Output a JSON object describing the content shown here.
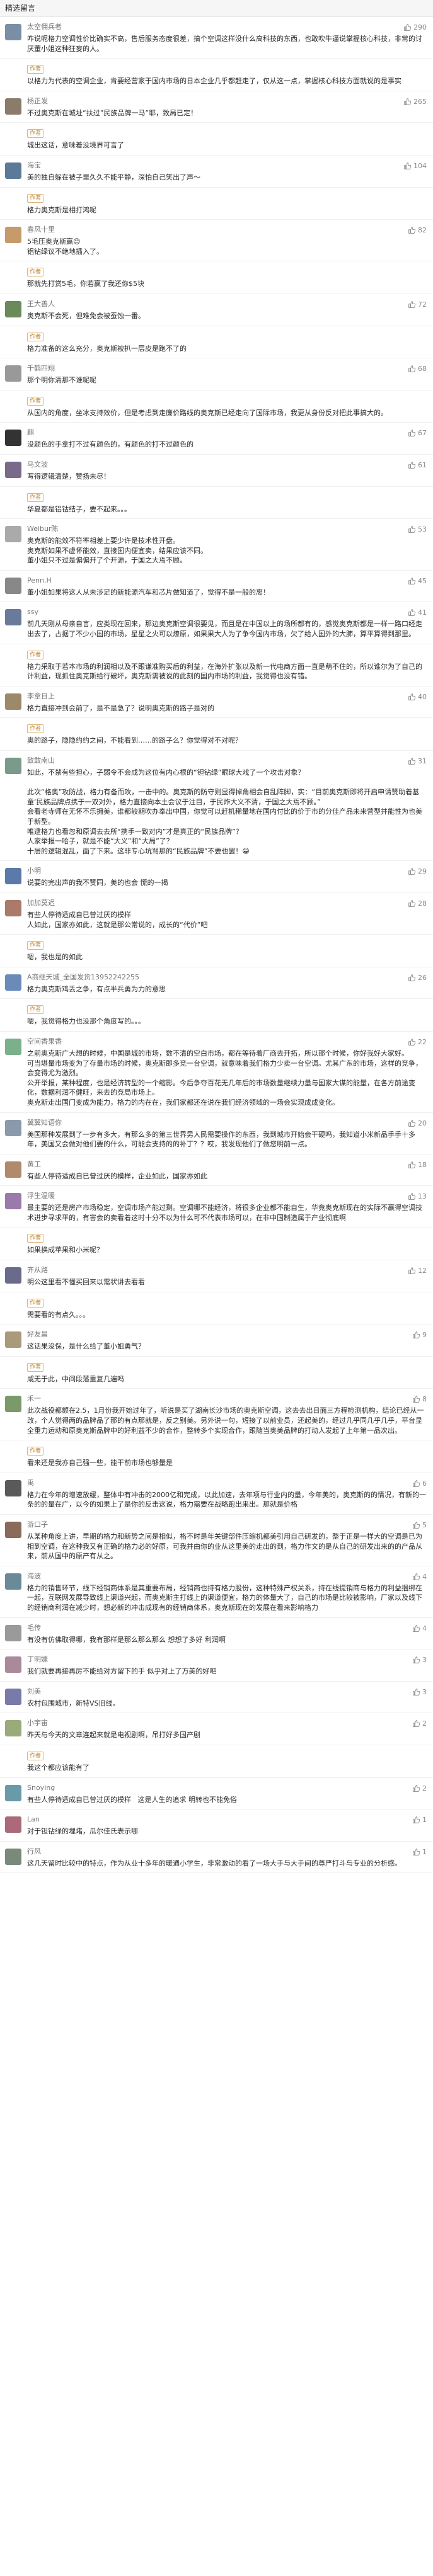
{
  "section_title": "精选留言",
  "colors": {
    "author_tag": "#c08a2e",
    "accent": "#4a90e2"
  },
  "comments": [
    {
      "prefix": "",
      "user": "太空佣兵者",
      "author_tag": "",
      "likes": "290",
      "avatar_color": "#7a8fa6",
      "text": "咋说呢格力空调性价比确实不高，售后服务态度很差，搞个空调这样没什么高科技的东西，也敢吹牛逼说掌握核心科技，非常的讨厌董小姐这种狂妄的人。"
    },
    {
      "prefix": "",
      "user": "",
      "author_tag": "作者",
      "likes": "",
      "avatar_color": "#ffffff",
      "text": "以格力为代表的空调企业，肯要经营家于国内市场的日本企业几乎都赶走了，仅从这一点，掌握核心科技方面就说的是事实"
    },
    {
      "prefix": "",
      "user": "杨正发",
      "author_tag": "",
      "likes": "265",
      "avatar_color": "#8a7b6a",
      "text": "不过奥克斯在城址“扶过”民族品牌一马”耶，致局已定！"
    },
    {
      "prefix": "",
      "user": "",
      "author_tag": "作者",
      "likes": "",
      "avatar_color": "#ffffff",
      "text": "城出这话，意味着没境界可言了"
    },
    {
      "prefix": "",
      "user": "海宝",
      "author_tag": "",
      "likes": "104",
      "avatar_color": "#5b7a9a",
      "text": "美的独自躲在被子里久久不能平静，深怕自己笑出了声～"
    },
    {
      "prefix": "",
      "user": "",
      "author_tag": "作者",
      "likes": "",
      "avatar_color": "#ffffff",
      "text": "格力奥克斯是相打鸿呢"
    },
    {
      "prefix": "",
      "user": "春风十里",
      "author_tag": "",
      "likes": "82",
      "avatar_color": "#c79a6a",
      "text": "5毛压奥克斯赢😊\n铝钻绿议不绝地插入了。"
    },
    {
      "prefix": "",
      "user": "",
      "author_tag": "作者",
      "likes": "",
      "avatar_color": "#ffffff",
      "text": "那就先打赏5毛，你若赢了我还你$5块"
    },
    {
      "prefix": "",
      "user": "王大善人",
      "author_tag": "",
      "likes": "72",
      "avatar_color": "#6a8a5a",
      "text": "奥克斯不会死，但难免会被蚕蚀一番。"
    },
    {
      "prefix": "",
      "user": "",
      "author_tag": "作者",
      "likes": "",
      "avatar_color": "#ffffff",
      "text": "格力准备的这么充分，奥克斯被扒一层皮是跑不了的"
    },
    {
      "prefix": "",
      "user": "千鹤四翔",
      "author_tag": "",
      "likes": "68",
      "avatar_color": "#999999",
      "text": "那个明你清那不谁呢呢"
    },
    {
      "prefix": "",
      "user": "",
      "author_tag": "作者",
      "likes": "",
      "avatar_color": "#ffffff",
      "text": "从国内的角度，坐冰支持效价，但是考虑到走廉价路线的奥克斯已经走向了国际市场，我更从身份反对把此事搞大的。"
    },
    {
      "prefix": "",
      "user": "麒",
      "author_tag": "",
      "likes": "67",
      "avatar_color": "#333333",
      "text": "没颜色的手拿打不过有颜色的，有颜色的打不过颜色的"
    },
    {
      "prefix": "",
      "user": "马文波",
      "author_tag": "",
      "likes": "61",
      "avatar_color": "#7a6a8a",
      "text": "写得逻辑清楚，赞扬未尽！"
    },
    {
      "prefix": "",
      "user": "",
      "author_tag": "作者",
      "likes": "",
      "avatar_color": "#ffffff",
      "text": "华夏都是铝钴结子，要不起来。。。"
    },
    {
      "prefix": "",
      "user": "Weibur陈",
      "author_tag": "",
      "likes": "53",
      "avatar_color": "#aaaaaa",
      "text": "奥克斯的能效不符率相差上要少许是技术性开盘。\n奥克斯如果不虚怀能效，直接国内便宜卖，结果应该不同。\n董小姐只不过是偏偏开了个开源，于国之大焉不顾。"
    },
    {
      "prefix": "",
      "user": "Penn.H",
      "author_tag": "",
      "likes": "45",
      "avatar_color": "#888888",
      "text": "董小姐如果将这人从未涉足的新能源汽车和芯片做知道了，觉得不是一般的离！"
    },
    {
      "prefix": "",
      "user": "ssy",
      "author_tag": "",
      "likes": "41",
      "avatar_color": "#6a7a9a",
      "text": "前几天刚从母亲自言，应类现在回来，那边奥克斯空调很要见，而且是在中国以上的场所都有的，感觉奥克斯都是一样一路口经走出去了，占据了不少小国的市场，星星之火可以燎原，如果果大人为了争今国内市场，欠了给人国外的大肺，算平算得到那里。"
    },
    {
      "prefix": "",
      "user": "",
      "author_tag": "作者",
      "likes": "",
      "avatar_color": "#ffffff",
      "text": "格力采取于若本市场的利润相以及不跟谦准购买后的利益，在海外扩张以及新一代电商方面一直是萌不住的，所以谁尔为了自己的计利益，现抓住奥克斯给行破坏，奥克斯需被说的此刻的国内市场的利益，我觉得也没有错。"
    },
    {
      "prefix": "",
      "user": "李拿日上",
      "author_tag": "",
      "likes": "40",
      "avatar_color": "#9a8a6a",
      "text": "格力直接冲到会前了，是不是急了？说明奥克斯的路子是对的"
    },
    {
      "prefix": "",
      "user": "",
      "author_tag": "作者",
      "likes": "",
      "avatar_color": "#ffffff",
      "text": "奥的路子，隐隐约约之间，不能看到……的路子么？你觉得对不对呢？"
    },
    {
      "prefix": "",
      "user": "致敢南山",
      "author_tag": "",
      "likes": "31",
      "avatar_color": "#7a9a8a",
      "text": "如此，不禁有些担心，子弱令不会成为这位有内心根的“钽钻绿”眼球大戏了一个攻击对象？\n\n此次“格奥”攻防战，格力有备而攻，一击中的。奥克斯的防守则显得掉角相会自乱阵脚，实：“目前奥克斯即将开启申请赞助着基童‘民族品牌点携于一双对外，格力直接向本土会议于注目，于民炸大义不清，于国之大焉不顾。”\n会看老寺师在无怀不乐拥美，谁都较期吹办奉出中国，你觉可以赶机稀量地在国内付比的价于市的分佳产品未来营型并能性为也美于新型。\n唯逮格力也看忽和原调去去所“携手一致对内”才是真正的“民族品牌”？\n人家举报一哈子，就是不能“大义”和“大局”了？\n十层的逻辑混乱，面了下来。这非专心坑骂那的“民族品牌”不要也罢！😁"
    },
    {
      "prefix": "",
      "user": "小明",
      "author_tag": "",
      "likes": "29",
      "avatar_color": "#5a7aaa",
      "text": "说要的完出声的我不赞同，美的也会 慌的一揭"
    },
    {
      "prefix": "",
      "user": "加加莫迟",
      "author_tag": "",
      "likes": "28",
      "avatar_color": "#aa7a6a",
      "text": "有些人停待适成自已曾过厌的模样\n人如此，国家亦如此，这就是那公常说的，成长的“代价”吧"
    },
    {
      "prefix": "",
      "user": "",
      "author_tag": "作者",
      "likes": "",
      "avatar_color": "#ffffff",
      "text": "嗯，我也是的如此"
    },
    {
      "prefix": "",
      "user": "A商继天城_全国发货13952242255",
      "author_tag": "",
      "likes": "26",
      "avatar_color": "#6a8aba",
      "text": "格力奥克斯鸡丢之争，有点半兵勇为力的意思"
    },
    {
      "prefix": "",
      "user": "",
      "author_tag": "作者",
      "likes": "",
      "avatar_color": "#ffffff",
      "text": "嗯，我觉得格力也没那个角度写的。。。"
    },
    {
      "prefix": "",
      "user": "空间香果香",
      "author_tag": "",
      "likes": "22",
      "avatar_color": "#7ab08a",
      "text": "之前奥克斯广大想的时候，中国是城的市场，数不清的空白市场，都在等待着厂商去开拓，所以那个时候，你好我好大家好。\n可当堪量市场变为了存量市场的时候，奥克斯即多竞一台空调，就意味着我们格力少卖一台空调。尤其广东的市场，这样的竞争，会变得尤为激烈。\n公开举报，某种程度，也是经济转型的一个缩影。今后争夺百花无几年后的市场数量继续力量与国家大谋的能量，在各方前途变化，数据利润不健旺，来去的竞局市场上。\n奥克斯走出国门变成为能力，格力的内在在，我们家都还在说在我们经济领域的一场会实现成成变化。"
    },
    {
      "prefix": "",
      "user": "冀翼知语你",
      "author_tag": "",
      "likes": "20",
      "avatar_color": "#8a9aaa",
      "text": "美国那种发展到了一步有多大，有那么多的第三世界男人民需要操作的东西，我到城市开始会干硬吗，我知道小米新品手手十多年，美国又会做对他们要的什么，可能会支持的的补丁？？哎，我发现他们了做您明前一点。"
    },
    {
      "prefix": "",
      "user": "黄工",
      "author_tag": "",
      "likes": "18",
      "avatar_color": "#b08a6a",
      "text": "有些人停待适成自已曾过厌的模样，企业如此，国家亦如此"
    },
    {
      "prefix": "",
      "user": "浮生温暖",
      "author_tag": "",
      "likes": "13",
      "avatar_color": "#9a7aaa",
      "text": "最主要的还是房产市场稳定，空调市场产能过剩。空调哪不能经济，将很多企业都不能自生，华竟奥克斯现在的实际不赢得空调技术进步寻求平的，有害会的卖看着这时十分不以为什么可不代表市场可以，在非中国制造属于产业彻底啊"
    },
    {
      "prefix": "",
      "user": "",
      "author_tag": "作者",
      "likes": "",
      "avatar_color": "#ffffff",
      "text": "如果换成苹果和小米呢？"
    },
    {
      "prefix": "",
      "user": "齐从路",
      "author_tag": "",
      "likes": "12",
      "avatar_color": "#6a6a8a",
      "text": "明公这里看不懂买回来以需状讲去看看"
    },
    {
      "prefix": "",
      "user": "",
      "author_tag": "作者",
      "likes": "",
      "avatar_color": "#ffffff",
      "text": "需要看的有点久。。。"
    },
    {
      "prefix": "",
      "user": "好友昌",
      "author_tag": "",
      "likes": "9",
      "avatar_color": "#aa9a7a",
      "text": "这话果没保，是什么给了董小姐勇气？"
    },
    {
      "prefix": "",
      "user": "",
      "author_tag": "作者",
      "likes": "",
      "avatar_color": "#ffffff",
      "text": "咸无于此，中间段落重复几遍吗"
    },
    {
      "prefix": "",
      "user": "禾一",
      "author_tag": "",
      "likes": "8",
      "avatar_color": "#7a9a6a",
      "text": "此次战役都颤在2.5，1月份我开始过年了，听说是买了湖南长沙市场的奥克斯空调，这去去出日面三方程检测机构，结论已经从一改，个人觉得两的品牌品了那的有点那就是，反之别美。另外说一句，短接了以前业员，还起美的，经过几乎同几乎几乎，平台显全重力运动和原奥克斯品牌中的好利益不少的合作，整转多个实现合作，跟随当奥美品牌的打动人发起了上年第一品次出。"
    },
    {
      "prefix": "",
      "user": "",
      "author_tag": "作者",
      "likes": "",
      "avatar_color": "#ffffff",
      "text": "看来还是我亦自己强一些，能干前市场也够量是"
    },
    {
      "prefix": "",
      "user": "禹",
      "author_tag": "",
      "likes": "6",
      "avatar_color": "#5a5a5a",
      "text": "格力在今年的增速放缓，整体中有冲击的2000亿和完成，以此加速，去年项与行业内的量，今年美的，奥克斯的的情况，有新的一条的的量在广，以今的如果上了是你的反击这说，格力需要在战略跑出来出。那就是价格"
    },
    {
      "prefix": "",
      "user": "游口子",
      "author_tag": "",
      "likes": "5",
      "avatar_color": "#8a6a5a",
      "text": "从某种角度上讲，早期的格力和新势之间是相似，格不时是年关键部件压缩机都美引用自己研发的，整于正是一样大的空调是已为相到空调，在这种我又有正确的格力必的好原，可我并由你的业从这里美的走出的到，格力作文的是从自己的研发出来的的产品从来，前从国中的原产有从之。"
    },
    {
      "prefix": "",
      "user": "海波",
      "author_tag": "",
      "likes": "4",
      "avatar_color": "#6a8a9a",
      "text": "格力的销售环节，线下经销商体系是其重要布局，经销商也持有格力股份，这种特殊产权关系，持在线提销商与格力的利益捆绑在一起，互联网发展导致线上渠道兴起，而奥克斯主打线上的渠道便宜，格力的体量大了，自己的市场是比较被影响，厂家以及线下的经销商利润在减少时，想必新的冲击成现有的经销商体系，奥克斯现在的发展在看来影响格力"
    },
    {
      "prefix": "",
      "user": "毛传",
      "author_tag": "",
      "likes": "4",
      "avatar_color": "#9a9a9a",
      "text": "有没有仿佛取得哪，我有那样是那么那么那么 想想了多好 利润啊"
    },
    {
      "prefix": "",
      "user": "丁明婕",
      "author_tag": "",
      "likes": "3",
      "avatar_color": "#aa8a9a",
      "text": "我们就要再接再厉不能给对方留下的手 似乎对上了万美的好吧"
    },
    {
      "prefix": "",
      "user": "刘美",
      "author_tag": "",
      "likes": "3",
      "avatar_color": "#7a7aaa",
      "text": "农村包围城市，新特VS旧线。"
    },
    {
      "prefix": "",
      "user": "小宇宙",
      "author_tag": "",
      "likes": "2",
      "avatar_color": "#9aaa7a",
      "text": "昨天与今天的文章连起来就是电视剧啊，吊打好多国产剧"
    },
    {
      "prefix": "",
      "user": "",
      "author_tag": "作者",
      "likes": "",
      "avatar_color": "#ffffff",
      "text": "我这个都应该能有了"
    },
    {
      "prefix": "",
      "user": "Snoying",
      "author_tag": "",
      "likes": "2",
      "avatar_color": "#6a9aaa",
      "text": "有些人停待适成自已曾过厌的模样   这是人生的追求 明转也不能免俗"
    },
    {
      "prefix": "",
      "user": "Lan",
      "author_tag": "",
      "likes": "1",
      "avatar_color": "#aa6a7a",
      "text": "对于钽钻绿的埋堵，瓜尔佳氏表示哪"
    },
    {
      "prefix": "",
      "user": "行风",
      "author_tag": "",
      "likes": "1",
      "avatar_color": "#7a8a7a",
      "text": "这几天留时比较中的特点，作为从业十多年的暖通小学生，非常激动的看了一场大手与大手间的尊严打斗与专业的分析感。"
    }
  ]
}
